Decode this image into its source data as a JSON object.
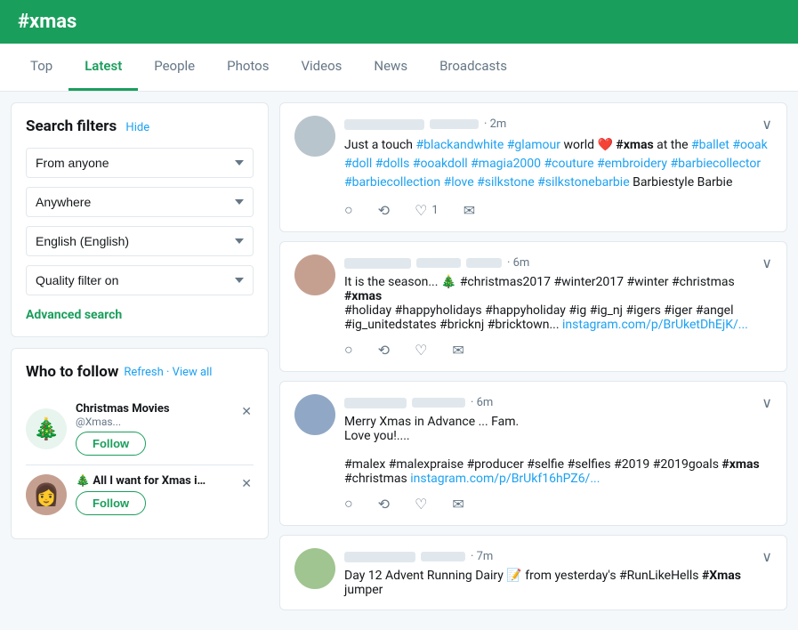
{
  "header": {
    "title": "#xmas"
  },
  "tabs": [
    {
      "id": "top",
      "label": "Top",
      "active": false
    },
    {
      "id": "latest",
      "label": "Latest",
      "active": true
    },
    {
      "id": "people",
      "label": "People",
      "active": false
    },
    {
      "id": "photos",
      "label": "Photos",
      "active": false
    },
    {
      "id": "videos",
      "label": "Videos",
      "active": false
    },
    {
      "id": "news",
      "label": "News",
      "active": false
    },
    {
      "id": "broadcasts",
      "label": "Broadcasts",
      "active": false
    }
  ],
  "sidebar": {
    "filters": {
      "title": "Search filters",
      "hide_label": "Hide",
      "from_label": "From anyone",
      "location_label": "Anywhere",
      "language_label": "English (English)",
      "quality_label": "Quality filter on",
      "advanced_search": "Advanced search"
    },
    "who_to_follow": {
      "title": "Who to follow",
      "refresh_label": "Refresh",
      "view_all_label": "View all",
      "accounts": [
        {
          "name": "Christmas Movies",
          "handle": "@Xmas...",
          "follow_label": "Follow",
          "emoji": "🎄"
        },
        {
          "name": "🎄 All I want for Xmas is ...",
          "handle": "",
          "follow_label": "Follow",
          "emoji": "👩"
        }
      ]
    }
  },
  "feed": {
    "tweets": [
      {
        "time": "2m",
        "body_parts": [
          {
            "type": "text",
            "text": "Just a touch "
          },
          {
            "type": "hashtag",
            "text": "#blackandwhite"
          },
          {
            "type": "text",
            "text": " "
          },
          {
            "type": "hashtag",
            "text": "#glamour"
          },
          {
            "type": "text",
            "text": " world ❤️ "
          },
          {
            "type": "bold",
            "text": "#xmas"
          },
          {
            "type": "text",
            "text": " at the "
          },
          {
            "type": "hashtag",
            "text": "#ballet"
          },
          {
            "type": "text",
            "text": " "
          },
          {
            "type": "hashtag",
            "text": "#ooak"
          },
          {
            "type": "text",
            "text": " "
          },
          {
            "type": "hashtag",
            "text": "#doll"
          },
          {
            "type": "text",
            "text": " "
          },
          {
            "type": "hashtag",
            "text": "#dolls"
          },
          {
            "type": "text",
            "text": " "
          },
          {
            "type": "hashtag",
            "text": "#ooakdoll"
          },
          {
            "type": "text",
            "text": " "
          },
          {
            "type": "hashtag",
            "text": "#magia2000"
          },
          {
            "type": "text",
            "text": " "
          },
          {
            "type": "hashtag",
            "text": "#couture"
          },
          {
            "type": "text",
            "text": " "
          },
          {
            "type": "hashtag",
            "text": "#embroidery"
          },
          {
            "type": "text",
            "text": " "
          },
          {
            "type": "hashtag",
            "text": "#barbiecollector"
          },
          {
            "type": "text",
            "text": " "
          },
          {
            "type": "hashtag",
            "text": "#barbiecollection"
          },
          {
            "type": "text",
            "text": " "
          },
          {
            "type": "hashtag",
            "text": "#love"
          },
          {
            "type": "text",
            "text": " "
          },
          {
            "type": "hashtag",
            "text": "#silkstone"
          },
          {
            "type": "text",
            "text": " "
          },
          {
            "type": "hashtag",
            "text": "#silkstonebarbie"
          },
          {
            "type": "text",
            "text": " Barbiestyle Barbie"
          }
        ],
        "likes": "1",
        "avatar_bg": "#b8c5cc"
      },
      {
        "time": "6m",
        "body_parts": [
          {
            "type": "text",
            "text": "It is the season... 🎄 "
          },
          {
            "type": "hashtag",
            "text": "#christmas2017"
          },
          {
            "type": "text",
            "text": " "
          },
          {
            "type": "hashtag",
            "text": "#winter2017"
          },
          {
            "type": "text",
            "text": " "
          },
          {
            "type": "hashtag",
            "text": "#winter"
          },
          {
            "type": "text",
            "text": " "
          },
          {
            "type": "hashtag",
            "text": "#christmas"
          },
          {
            "type": "text",
            "text": " "
          },
          {
            "type": "bold",
            "text": "#xmas"
          },
          {
            "type": "text",
            "text": "\n"
          },
          {
            "type": "hashtag",
            "text": "#holiday"
          },
          {
            "type": "text",
            "text": " "
          },
          {
            "type": "hashtag",
            "text": "#happyholidays"
          },
          {
            "type": "text",
            "text": " "
          },
          {
            "type": "hashtag",
            "text": "#happyholiday"
          },
          {
            "type": "text",
            "text": " "
          },
          {
            "type": "hashtag",
            "text": "#ig"
          },
          {
            "type": "text",
            "text": " "
          },
          {
            "type": "hashtag",
            "text": "#ig_nj"
          },
          {
            "type": "text",
            "text": " "
          },
          {
            "type": "hashtag",
            "text": "#igers"
          },
          {
            "type": "text",
            "text": " "
          },
          {
            "type": "hashtag",
            "text": "#iger"
          },
          {
            "type": "text",
            "text": " "
          },
          {
            "type": "hashtag",
            "text": "#angel"
          },
          {
            "type": "text",
            "text": "\n"
          },
          {
            "type": "hashtag",
            "text": "#ig_unitedstates"
          },
          {
            "type": "text",
            "text": " "
          },
          {
            "type": "hashtag",
            "text": "#bricknj"
          },
          {
            "type": "text",
            "text": " "
          },
          {
            "type": "hashtag",
            "text": "#bricktown"
          },
          {
            "type": "text",
            "text": "... "
          },
          {
            "type": "link",
            "text": "instagram.com/p/BrUketDhEjK/..."
          }
        ],
        "likes": "",
        "avatar_bg": "#c5a090"
      },
      {
        "time": "6m",
        "body_parts": [
          {
            "type": "text",
            "text": "Merry Xmas in Advance ... Fam.\nLove you!....\n\n"
          },
          {
            "type": "hashtag",
            "text": "#malex"
          },
          {
            "type": "text",
            "text": " "
          },
          {
            "type": "hashtag",
            "text": "#malexpraise"
          },
          {
            "type": "text",
            "text": " "
          },
          {
            "type": "hashtag",
            "text": "#producer"
          },
          {
            "type": "text",
            "text": " "
          },
          {
            "type": "hashtag",
            "text": "#selfie"
          },
          {
            "type": "text",
            "text": " "
          },
          {
            "type": "hashtag",
            "text": "#selfies"
          },
          {
            "type": "text",
            "text": " "
          },
          {
            "type": "hashtag",
            "text": "#2019"
          },
          {
            "type": "text",
            "text": " "
          },
          {
            "type": "hashtag",
            "text": "#2019goals"
          },
          {
            "type": "text",
            "text": " "
          },
          {
            "type": "bold",
            "text": "#xmas"
          },
          {
            "type": "text",
            "text": "\n"
          },
          {
            "type": "hashtag",
            "text": "#christmas"
          },
          {
            "type": "text",
            "text": " "
          },
          {
            "type": "link",
            "text": "instagram.com/p/BrUkf16hPZ6/..."
          }
        ],
        "likes": "",
        "avatar_bg": "#90a8c5"
      },
      {
        "time": "7m",
        "body_parts": [
          {
            "type": "text",
            "text": "Day 12 Advent Running Dairy 📝 from yesterday's "
          },
          {
            "type": "hashtag",
            "text": "#RunLikeHells"
          },
          {
            "type": "text",
            "text": " "
          },
          {
            "type": "bold",
            "text": "#Xmas"
          },
          {
            "type": "text",
            "text": " jumper"
          }
        ],
        "likes": "",
        "avatar_bg": "#a0c590"
      }
    ]
  },
  "icons": {
    "reply": "○",
    "retweet": "⟲",
    "like": "♡",
    "dm": "✉",
    "chevron_down": "∨"
  }
}
